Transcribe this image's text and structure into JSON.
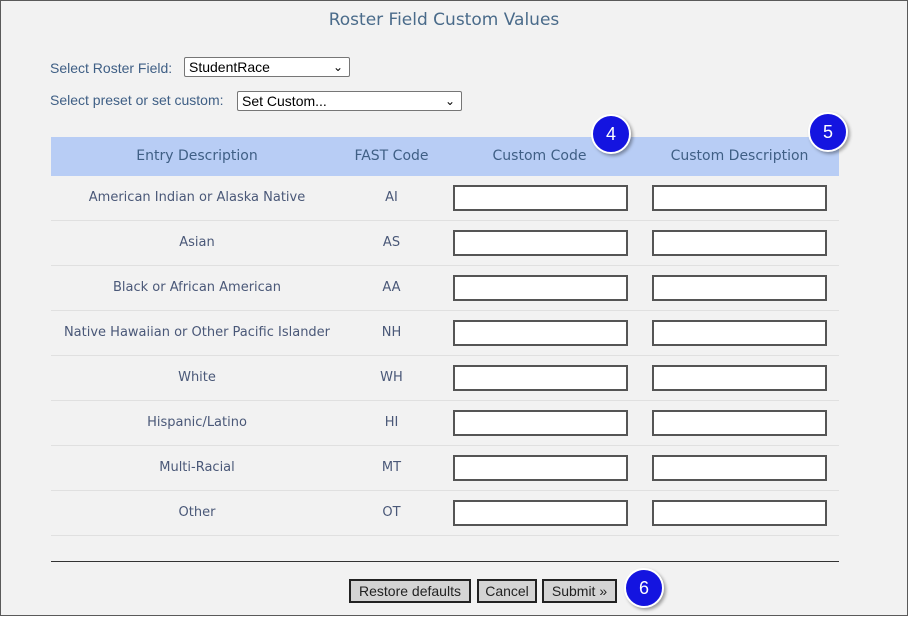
{
  "page": {
    "title": "Roster Field Custom Values"
  },
  "roster_field": {
    "label": "Select Roster Field:",
    "value": "StudentRace"
  },
  "preset": {
    "label": "Select preset or set custom:",
    "value": "Set Custom..."
  },
  "table": {
    "headers": [
      "Entry Description",
      "FAST Code",
      "Custom Code",
      "Custom Description"
    ],
    "rows": [
      {
        "description": "American Indian or Alaska Native",
        "code": "AI"
      },
      {
        "description": "Asian",
        "code": "AS"
      },
      {
        "description": "Black or African American",
        "code": "AA"
      },
      {
        "description": "Native Hawaiian or Other Pacific Islander",
        "code": "NH"
      },
      {
        "description": "White",
        "code": "WH"
      },
      {
        "description": "Hispanic/Latino",
        "code": "HI"
      },
      {
        "description": "Multi-Racial",
        "code": "MT"
      },
      {
        "description": "Other",
        "code": "OT"
      }
    ]
  },
  "buttons": {
    "restore": "Restore defaults",
    "cancel": "Cancel",
    "submit": "Submit »"
  },
  "callouts": {
    "custom_code": "4",
    "custom_description": "5",
    "submit": "6"
  },
  "colors": {
    "header_bg": "#b8cdf5",
    "callout": "#1414e0",
    "text": "#3f5f85"
  }
}
